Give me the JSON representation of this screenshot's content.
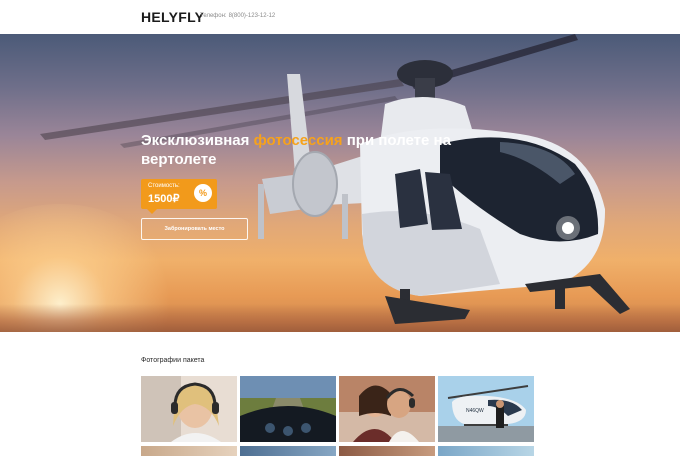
{
  "header": {
    "logo": "HELYFLY",
    "phone_label": "Телефон:",
    "phone_number": "8(800)-123-12-12"
  },
  "hero": {
    "title_part1": "Эксклюзивная ",
    "title_accent": "фотосессия",
    "title_part2": " при полете на вертолете",
    "price_label": "Стоимость:",
    "price_value": "1500₽",
    "percent_symbol": "%",
    "book_button": "Забронировать место"
  },
  "gallery": {
    "title": "Фотографии пакета",
    "photo_1_text": "",
    "photo_4_tail": "N46QW"
  },
  "colors": {
    "accent": "#f29a1b",
    "accent_text": "#f7a21b"
  }
}
